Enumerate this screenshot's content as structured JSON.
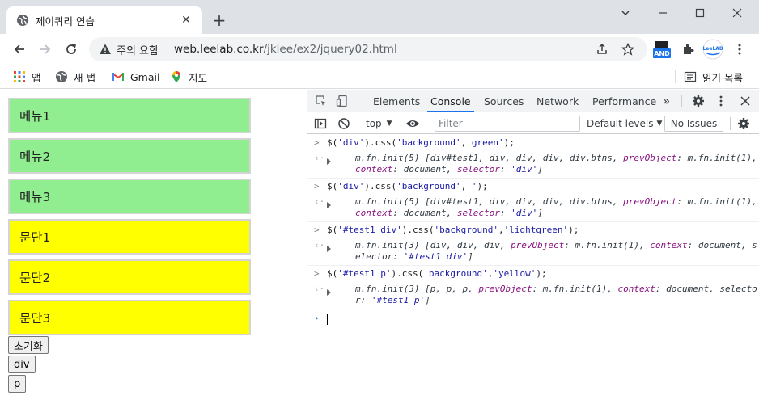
{
  "browser": {
    "tab_title": "제이쿼리 연습",
    "new_tab_label": "+",
    "security_warning": "주의 요함",
    "url_host": "web.leelab.co.kr",
    "url_path": "/jklee/ex2/jquery02.html",
    "extension_badge": "AND",
    "profile_label": "LeeLAB"
  },
  "bookmarks": {
    "items": [
      {
        "label": "앱",
        "icon": "apps-grid-icon"
      },
      {
        "label": "새 탭",
        "icon": "globe-icon"
      },
      {
        "label": "Gmail",
        "icon": "gmail-icon"
      },
      {
        "label": "지도",
        "icon": "maps-pin-icon"
      }
    ],
    "reading_list": "읽기 목록"
  },
  "page": {
    "boxes": [
      {
        "label": "메뉴1",
        "color": "#90ee90"
      },
      {
        "label": "메뉴2",
        "color": "#90ee90"
      },
      {
        "label": "메뉴3",
        "color": "#90ee90"
      },
      {
        "label": "문단1",
        "color": "#ffff00"
      },
      {
        "label": "문단2",
        "color": "#ffff00"
      },
      {
        "label": "문단3",
        "color": "#ffff00"
      }
    ],
    "buttons": [
      "초기화",
      "div",
      "p"
    ]
  },
  "devtools": {
    "tabs": [
      "Elements",
      "Console",
      "Sources",
      "Network",
      "Performance"
    ],
    "active_tab": "Console",
    "more_tabs": "»",
    "context": "top",
    "filter_placeholder": "Filter",
    "levels": "Default levels",
    "issues": "No Issues",
    "console": [
      {
        "input": "$('div').css('background','green');",
        "output_1": "m.fn.init(5) [div#test1, div, div, div, div.btns, prevObject: m.fn.init(1),",
        "output_2": "context: document, selector: 'div']"
      },
      {
        "input": "$('div').css('background','');",
        "output_1": "m.fn.init(5) [div#test1, div, div, div, div.btns, prevObject: m.fn.init(1),",
        "output_2": "context: document, selector: 'div']"
      },
      {
        "input": "$('#test1 div').css('background','lightgreen');",
        "output_1": "m.fn.init(3) [div, div, div, prevObject: m.fn.init(1), context: document, s",
        "output_2": "elector: '#test1 div']"
      },
      {
        "input": "$('#test1 p').css('background','yellow');",
        "output_1": "m.fn.init(3) [p, p, p, prevObject: m.fn.init(1), context: document, selecto",
        "output_2": "r: '#test1 p']"
      }
    ]
  },
  "colors": {
    "menu_bg": "#90ee90",
    "paragraph_bg": "#ffff00",
    "devtools_accent": "#1a73e8"
  }
}
